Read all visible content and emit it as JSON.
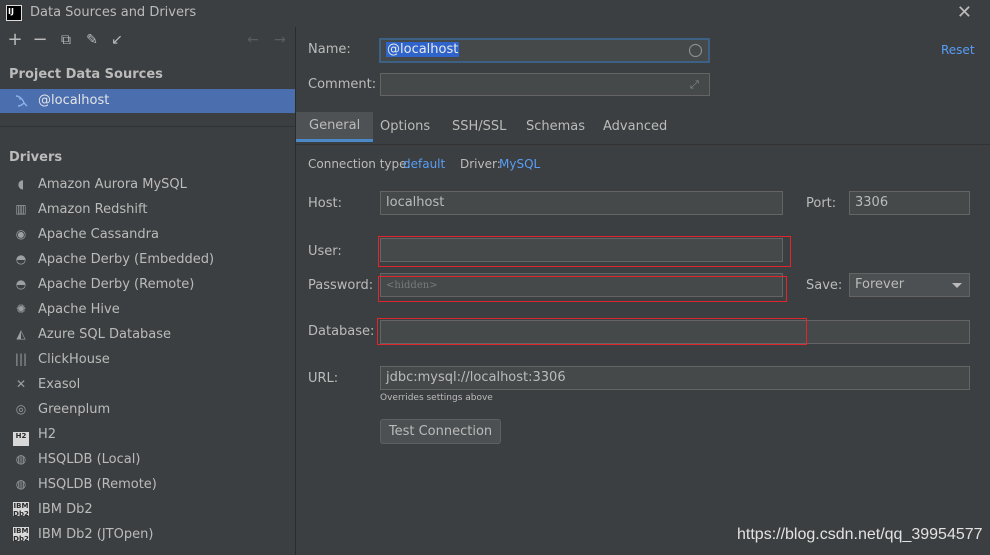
{
  "window": {
    "title": "Data Sources and Drivers",
    "logo_text": "IJ"
  },
  "sidebar": {
    "toolbar": {
      "add_icon": "+",
      "remove_icon": "−",
      "duplicate_icon": "⧉",
      "settings_icon": "✎",
      "import_icon": "↙",
      "back_icon": "←",
      "forward_icon": "→"
    },
    "project_heading": "Project Data Sources",
    "project_items": [
      {
        "label": "@localhost"
      }
    ],
    "drivers_heading": "Drivers",
    "drivers": [
      {
        "label": "Amazon Aurora MySQL",
        "icon": "dolphin-icon",
        "glyph": "◖"
      },
      {
        "label": "Amazon Redshift",
        "icon": "redshift-icon",
        "glyph": "▥"
      },
      {
        "label": "Apache Cassandra",
        "icon": "eye-icon",
        "glyph": "◉"
      },
      {
        "label": "Apache Derby (Embedded)",
        "icon": "derby-hat-icon",
        "glyph": "◓"
      },
      {
        "label": "Apache Derby (Remote)",
        "icon": "derby-hat-icon",
        "glyph": "◓"
      },
      {
        "label": "Apache Hive",
        "icon": "hive-icon",
        "glyph": "✺"
      },
      {
        "label": "Azure SQL Database",
        "icon": "azure-icon",
        "glyph": "◭"
      },
      {
        "label": "ClickHouse",
        "icon": "clickhouse-icon",
        "glyph": "|||"
      },
      {
        "label": "Exasol",
        "icon": "exasol-icon",
        "glyph": "✕"
      },
      {
        "label": "Greenplum",
        "icon": "greenplum-icon",
        "glyph": "◎"
      },
      {
        "label": "H2",
        "icon": "h2-icon",
        "glyph": "H2"
      },
      {
        "label": "HSQLDB (Local)",
        "icon": "hsqldb-icon",
        "glyph": "◍"
      },
      {
        "label": "HSQLDB (Remote)",
        "icon": "hsqldb-icon",
        "glyph": "◍"
      },
      {
        "label": "IBM Db2",
        "icon": "ibm-db2-icon",
        "glyph": "IBM Db2"
      },
      {
        "label": "IBM Db2 (JTOpen)",
        "icon": "ibm-db2-icon",
        "glyph": "IBM Db2"
      }
    ]
  },
  "form": {
    "name_label": "Name:",
    "name_value": "@localhost",
    "reset_label": "Reset",
    "comment_label": "Comment:",
    "comment_value": "",
    "tabs": [
      {
        "label": "General",
        "active": true
      },
      {
        "label": "Options"
      },
      {
        "label": "SSH/SSL"
      },
      {
        "label": "Schemas"
      },
      {
        "label": "Advanced"
      }
    ],
    "connection_type_label": "Connection type:",
    "connection_type_value": "default",
    "driver_label": "Driver:",
    "driver_value": "MySQL",
    "host_label": "Host:",
    "host_value": "localhost",
    "port_label": "Port:",
    "port_value": "3306",
    "user_label": "User:",
    "user_value": "",
    "password_label": "Password:",
    "password_placeholder": "<hidden>",
    "save_label": "Save:",
    "save_value": "Forever",
    "database_label": "Database:",
    "database_value": "",
    "url_label": "URL:",
    "url_value": "jdbc:mysql://localhost:3306",
    "url_hint": "Overrides settings above",
    "test_connection_label": "Test Connection"
  },
  "watermark": "https://blog.csdn.net/qq_39954577",
  "colors": {
    "background": "#3c3f41",
    "selection": "#4b6eaf",
    "link": "#589df6",
    "highlight_box": "#e0262c"
  }
}
